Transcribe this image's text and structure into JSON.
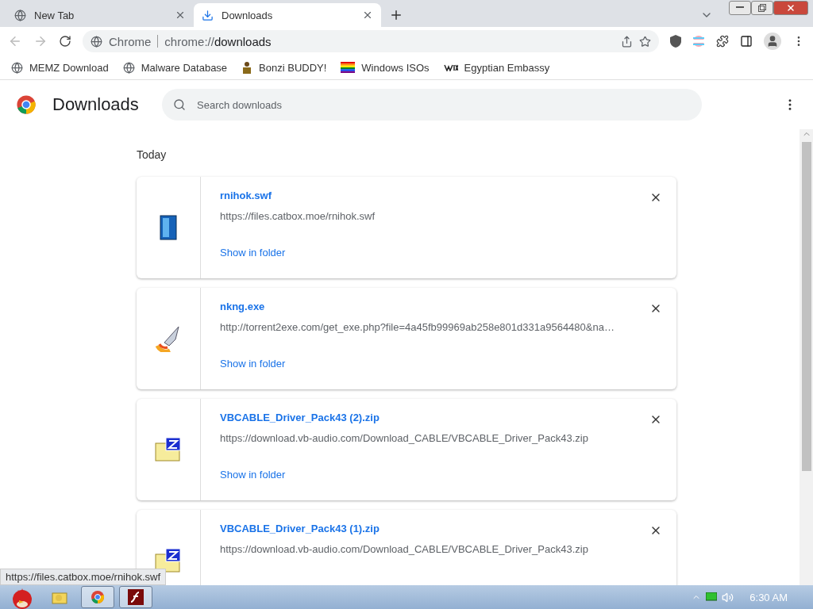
{
  "tabs": [
    {
      "title": "New Tab",
      "selected": false
    },
    {
      "title": "Downloads",
      "selected": true
    }
  ],
  "omnibox": {
    "origin": "Chrome",
    "url_prefix": "chrome://",
    "url_path": "downloads"
  },
  "bookmarks": [
    {
      "label": "MEMZ Download"
    },
    {
      "label": "Malware Database"
    },
    {
      "label": "Bonzi BUDDY!"
    },
    {
      "label": "Windows ISOs"
    },
    {
      "label": "Egyptian Embassy"
    }
  ],
  "page": {
    "title": "Downloads",
    "search_placeholder": "Search downloads",
    "section": "Today"
  },
  "downloads": [
    {
      "name": "rnihok.swf",
      "url": "https://files.catbox.moe/rnihok.swf",
      "action": "Show in folder"
    },
    {
      "name": "nkng.exe",
      "url": "http://torrent2exe.com/get_exe.php?file=4a45fb99969ab258e801d331a9564480&na…",
      "action": "Show in folder"
    },
    {
      "name": "VBCABLE_Driver_Pack43 (2).zip",
      "url": "https://download.vb-audio.com/Download_CABLE/VBCABLE_Driver_Pack43.zip",
      "action": "Show in folder"
    },
    {
      "name": "VBCABLE_Driver_Pack43 (1).zip",
      "url": "https://download.vb-audio.com/Download_CABLE/VBCABLE_Driver_Pack43.zip"
    }
  ],
  "status_url": "https://files.catbox.moe/rnihok.swf",
  "taskbar": {
    "clock": "6:30 AM",
    "apps": [
      {
        "selected": false
      },
      {
        "selected": true
      },
      {
        "selected": true
      }
    ]
  }
}
